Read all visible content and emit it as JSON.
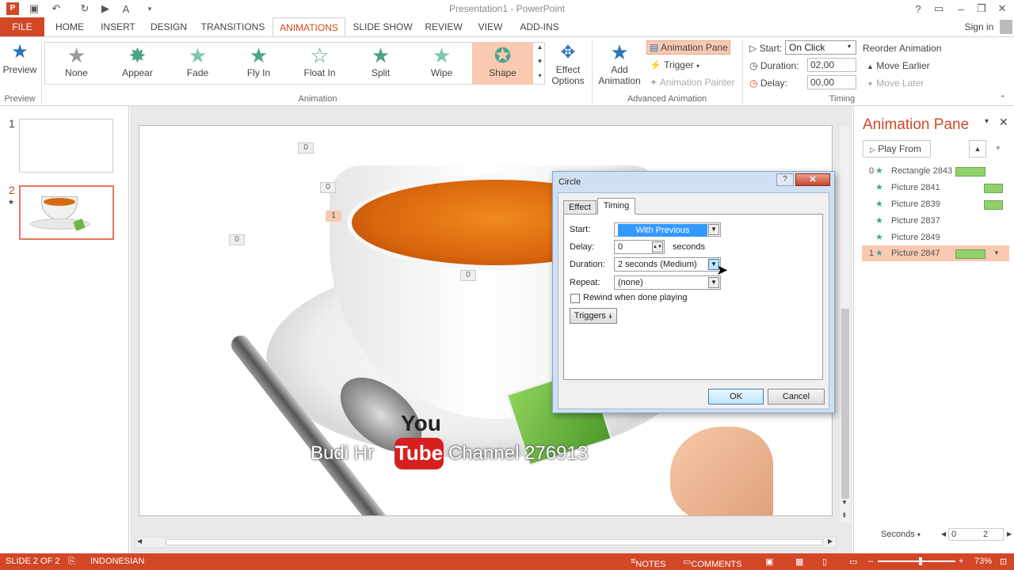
{
  "titlebar": {
    "title": "Presentation1 - PowerPoint",
    "signin": "Sign in"
  },
  "tabs": [
    "FILE",
    "HOME",
    "INSERT",
    "DESIGN",
    "TRANSITIONS",
    "ANIMATIONS",
    "SLIDE SHOW",
    "REVIEW",
    "VIEW",
    "ADD-INS"
  ],
  "ribbon": {
    "preview": {
      "label": "Preview",
      "group": "Preview"
    },
    "animations": [
      "None",
      "Appear",
      "Fade",
      "Fly In",
      "Float In",
      "Split",
      "Wipe",
      "Shape"
    ],
    "animation_group": "Animation",
    "effect_options": {
      "line1": "Effect",
      "line2": "Options"
    },
    "add_animation": {
      "line1": "Add",
      "line2": "Animation"
    },
    "animation_pane_btn": "Animation Pane",
    "trigger": "Trigger",
    "animation_painter": "Animation Painter",
    "advanced_group": "Advanced Animation",
    "start_label": "Start:",
    "start_value": "On Click",
    "duration_label": "Duration:",
    "duration_value": "02,00",
    "delay_label": "Delay:",
    "delay_value": "00,00",
    "reorder": "Reorder Animation",
    "move_earlier": "Move Earlier",
    "move_later": "Move Later",
    "timing_group": "Timing"
  },
  "slides": [
    "1",
    "2"
  ],
  "slide_tags": [
    "0",
    "0",
    "1",
    "0",
    "0"
  ],
  "watermark": {
    "you": "You",
    "tube": "Tube",
    "left": "Budi Hr",
    "right": "Channel 276913"
  },
  "anim_pane": {
    "title": "Animation Pane",
    "play_from": "Play From",
    "items": [
      {
        "num": "0",
        "name": "Rectangle 2843",
        "bar": "long"
      },
      {
        "num": "",
        "name": "Picture 2841",
        "bar": "short"
      },
      {
        "num": "",
        "name": "Picture 2839",
        "bar": "short"
      },
      {
        "num": "",
        "name": "Picture 2837",
        "bar": "none"
      },
      {
        "num": "",
        "name": "Picture 2849",
        "bar": "none"
      },
      {
        "num": "1",
        "name": "Picture 2847",
        "bar": "long"
      }
    ],
    "seconds": "Seconds",
    "scale_start": "0",
    "scale_end": "2"
  },
  "status": {
    "slide": "SLIDE 2 OF 2",
    "lang": "INDONESIAN",
    "notes": "NOTES",
    "comments": "COMMENTS",
    "zoom": "73%"
  },
  "dialog": {
    "title": "Circle",
    "tab_effect": "Effect",
    "tab_timing": "Timing",
    "start_label": "Start:",
    "start_value": "With Previous",
    "delay_label": "Delay:",
    "delay_value": "0",
    "delay_unit": "seconds",
    "duration_label": "Duration:",
    "duration_value": "2 seconds (Medium)",
    "repeat_label": "Repeat:",
    "repeat_value": "(none)",
    "rewind": "Rewind when done playing",
    "triggers": "Triggers",
    "ok": "OK",
    "cancel": "Cancel"
  }
}
